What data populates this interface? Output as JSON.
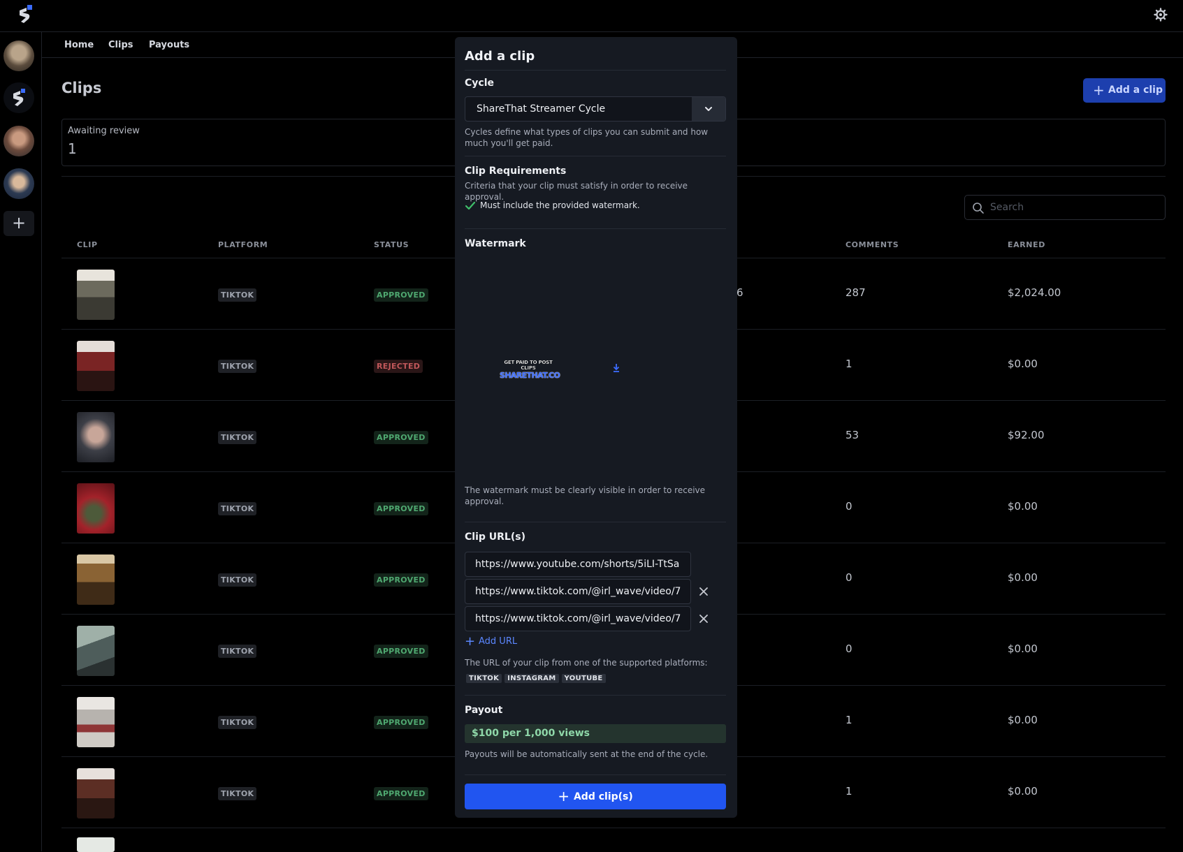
{
  "nav": {
    "home": "Home",
    "clips": "Clips",
    "payouts": "Payouts"
  },
  "page": {
    "title": "Clips",
    "add_clip_label": "Add a clip"
  },
  "stats": {
    "awaiting_label": "Awaiting review",
    "awaiting_value": "1"
  },
  "search": {
    "placeholder": "Search"
  },
  "table": {
    "headers": {
      "clip": "CLIP",
      "platform": "PLATFORM",
      "status": "STATUS",
      "comments": "COMMENTS",
      "earned": "EARNED"
    },
    "rows": [
      {
        "platform": "TIKTOK",
        "status": "APPROVED",
        "views_partial": "6",
        "comments": "287",
        "earned": "$2,024.00"
      },
      {
        "platform": "TIKTOK",
        "status": "REJECTED",
        "views_partial": "",
        "comments": "1",
        "earned": "$0.00"
      },
      {
        "platform": "TIKTOK",
        "status": "APPROVED",
        "views_partial": "",
        "comments": "53",
        "earned": "$92.00"
      },
      {
        "platform": "TIKTOK",
        "status": "APPROVED",
        "views_partial": "",
        "comments": "0",
        "earned": "$0.00"
      },
      {
        "platform": "TIKTOK",
        "status": "APPROVED",
        "views_partial": "",
        "comments": "0",
        "earned": "$0.00"
      },
      {
        "platform": "TIKTOK",
        "status": "APPROVED",
        "views_partial": "",
        "comments": "0",
        "earned": "$0.00"
      },
      {
        "platform": "TIKTOK",
        "status": "APPROVED",
        "views_partial": "",
        "comments": "1",
        "earned": "$0.00"
      },
      {
        "platform": "TIKTOK",
        "status": "APPROVED",
        "views_partial": "",
        "comments": "1",
        "earned": "$0.00"
      }
    ]
  },
  "modal": {
    "title": "Add a clip",
    "cycle_heading": "Cycle",
    "cycle_value": "ShareThat Streamer Cycle",
    "cycle_help": "Cycles define what types of clips you can submit and how much you'll get paid.",
    "req_heading": "Clip Requirements",
    "req_help": "Criteria that your clip must satisfy in order to receive approval.",
    "req_item": "Must include the provided watermark.",
    "watermark_heading": "Watermark",
    "watermark_logo_text": "SHARETHAT.CO",
    "watermark_tagline": "GET PAID TO POST CLIPS",
    "watermark_help": "The watermark must be clearly visible in order to receive approval.",
    "urls_heading": "Clip URL(s)",
    "urls": [
      "https://www.youtube.com/shorts/5iLI-TtSa",
      "https://www.tiktok.com/@irl_wave/video/7",
      "https://www.tiktok.com/@irl_wave/video/7"
    ],
    "add_url_label": "Add URL",
    "urls_help": "The URL of your clip from one of the supported platforms:",
    "platforms": [
      "TIKTOK",
      "INSTAGRAM",
      "YOUTUBE"
    ],
    "payout_heading": "Payout",
    "payout_rate": "$100 per 1,000 views",
    "payout_help": "Payouts will be automatically sent at the end of the cycle.",
    "submit_label": "Add clip(s)"
  },
  "colors": {
    "accent": "#2155f0",
    "approved": "#4fa870",
    "rejected": "#c0575a",
    "modal_bg": "#161a22"
  }
}
